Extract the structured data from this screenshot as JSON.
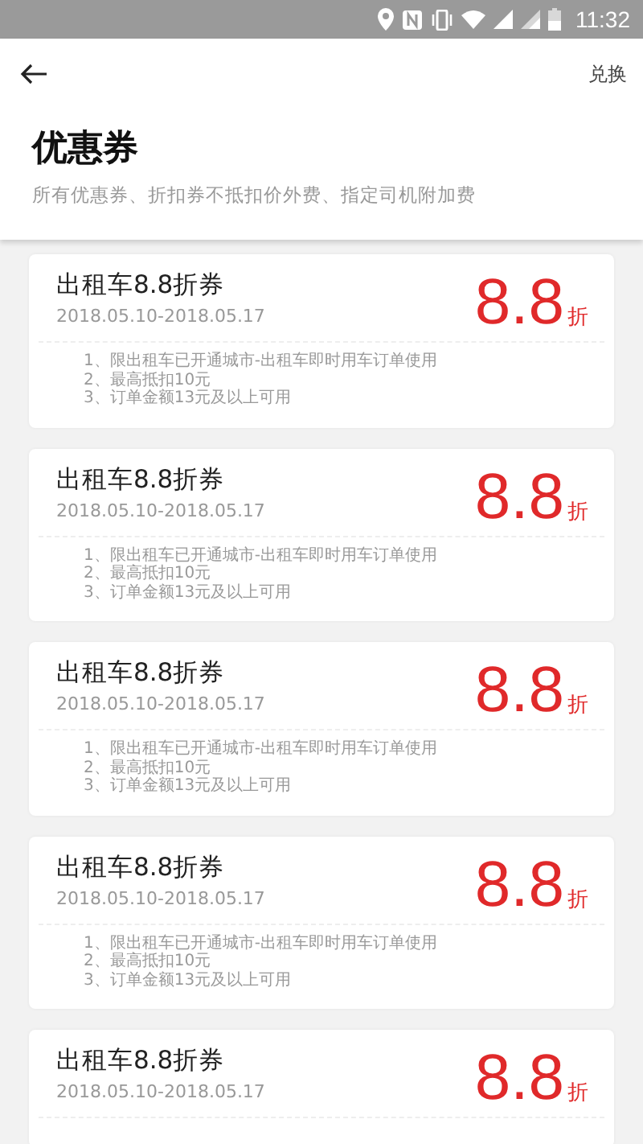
{
  "status_bar": {
    "time": "11:32"
  },
  "header": {
    "action": "兑换",
    "title": "优惠券",
    "subtitle": "所有优惠券、折扣券不抵扣价外费、指定司机附加费"
  },
  "coupons": [
    {
      "title": "出租车8.8折券",
      "dates": "2018.05.10-2018.05.17",
      "value": "8.8",
      "unit": "折",
      "rules": [
        "1、限出租车已开通城市-出租车即时用车订单使用",
        "2、最高抵扣10元",
        "3、订单金额13元及以上可用"
      ]
    },
    {
      "title": "出租车8.8折券",
      "dates": "2018.05.10-2018.05.17",
      "value": "8.8",
      "unit": "折",
      "rules": [
        "1、限出租车已开通城市-出租车即时用车订单使用",
        "2、最高抵扣10元",
        "3、订单金额13元及以上可用"
      ]
    },
    {
      "title": "出租车8.8折券",
      "dates": "2018.05.10-2018.05.17",
      "value": "8.8",
      "unit": "折",
      "rules": [
        "1、限出租车已开通城市-出租车即时用车订单使用",
        "2、最高抵扣10元",
        "3、订单金额13元及以上可用"
      ]
    },
    {
      "title": "出租车8.8折券",
      "dates": "2018.05.10-2018.05.17",
      "value": "8.8",
      "unit": "折",
      "rules": [
        "1、限出租车已开通城市-出租车即时用车订单使用",
        "2、最高抵扣10元",
        "3、订单金额13元及以上可用"
      ]
    },
    {
      "title": "出租车8.8折券",
      "dates": "2018.05.10-2018.05.17",
      "value": "8.8",
      "unit": "折"
    }
  ]
}
